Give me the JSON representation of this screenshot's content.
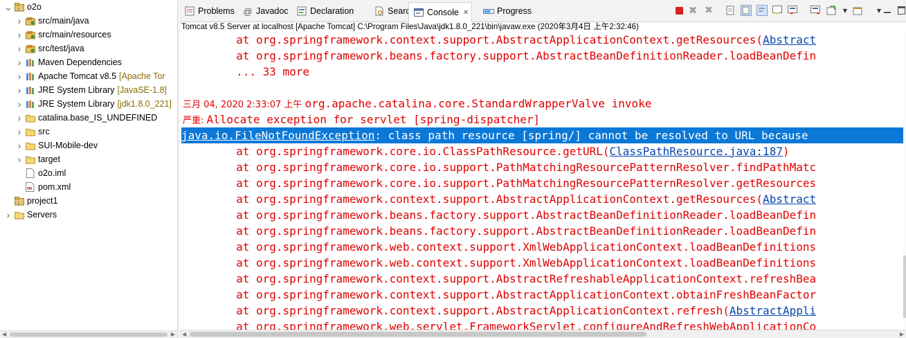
{
  "tree": {
    "items": [
      {
        "label": "o2o",
        "deco": "",
        "icon": "project-icon",
        "expanded": true
      },
      {
        "label": "src/main/java",
        "deco": "",
        "icon": "source-folder-icon",
        "expanded": false
      },
      {
        "label": "src/main/resources",
        "deco": "",
        "icon": "source-folder-icon",
        "expanded": false
      },
      {
        "label": "src/test/java",
        "deco": "",
        "icon": "source-folder-icon",
        "expanded": false
      },
      {
        "label": "Maven Dependencies",
        "deco": "",
        "icon": "library-icon",
        "expanded": false
      },
      {
        "label": "Apache Tomcat v8.5",
        "deco": "[Apache Tor",
        "icon": "library-icon",
        "expanded": false
      },
      {
        "label": "JRE System Library",
        "deco": "[JavaSE-1.8]",
        "icon": "library-icon",
        "expanded": false
      },
      {
        "label": "JRE System Library",
        "deco": "[jdk1.8.0_221]",
        "icon": "library-icon",
        "expanded": false
      },
      {
        "label": "catalina.base_IS_UNDEFINED",
        "deco": "",
        "icon": "folder-icon",
        "expanded": false
      },
      {
        "label": "src",
        "deco": "",
        "icon": "folder-icon",
        "expanded": false
      },
      {
        "label": "SUI-Mobile-dev",
        "deco": "",
        "icon": "folder-icon",
        "expanded": false
      },
      {
        "label": "target",
        "deco": "",
        "icon": "folder-icon",
        "expanded": false
      },
      {
        "label": "o2o.iml",
        "deco": "",
        "icon": "file-icon",
        "expanded": null
      },
      {
        "label": "pom.xml",
        "deco": "",
        "icon": "xml-file-icon",
        "expanded": null
      },
      {
        "label": "project1",
        "deco": "",
        "icon": "project-icon",
        "expanded": null
      },
      {
        "label": "Servers",
        "deco": "",
        "icon": "folder-icon",
        "expanded": false
      }
    ]
  },
  "tabs": [
    {
      "label": "Problems",
      "icon": "problems-icon",
      "active": false
    },
    {
      "label": "Javadoc",
      "icon": "javadoc-icon",
      "active": false
    },
    {
      "label": "Declaration",
      "icon": "declaration-icon",
      "active": false
    },
    {
      "label": "Search",
      "icon": "search-icon",
      "active": false
    },
    {
      "label": "Console",
      "icon": "console-icon",
      "active": true
    },
    {
      "label": "Progress",
      "icon": "progress-icon",
      "active": false
    }
  ],
  "toolbar": {
    "icons": [
      "terminate-icon",
      "remove-launch-icon",
      "remove-all-icon",
      "clear-console-icon",
      "scroll-lock-icon",
      "word-wrap-icon",
      "show-on-stdout-icon",
      "show-on-stderr-icon",
      "pin-console-icon",
      "display-console-icon",
      "chevron-down-icon",
      "new-console-icon",
      "chevron-down-icon",
      "minimize-icon",
      "maximize-icon"
    ]
  },
  "console": {
    "process_title": "Tomcat v8.5 Server at localhost [Apache Tomcat] C:\\Program Files\\Java\\jdk1.8.0_221\\bin\\javaw.exe (2020年3月4日 上午2:32:46)",
    "lines": [
      {
        "pre": "        at org.springframework.context.support.AbstractApplicationContext.getResources(",
        "link": "Abstract",
        "post": ""
      },
      {
        "pre": "        at org.springframework.beans.factory.support.AbstractBeanDefinitionReader.loadBeanDefin",
        "link": "",
        "post": ""
      },
      {
        "pre": "        ... 33 more",
        "link": "",
        "post": ""
      },
      {
        "pre": "",
        "link": "",
        "post": ""
      },
      {
        "cjk": "三月 04, 2020 2:33:07 上午 ",
        "pre": "org.apache.catalina.core.StandardWrapperValve invoke",
        "link": "",
        "post": ""
      },
      {
        "cjk": "严重: ",
        "pre": "Allocate exception for servlet [spring-dispatcher]",
        "link": "",
        "post": ""
      },
      {
        "pre": "",
        "link": "java.io.FileNotFoundException",
        "post": ": class path resource [spring/] cannot be resolved to URL because",
        "selected": true
      },
      {
        "pre": "        at org.springframework.core.io.ClassPathResource.getURL(",
        "link": "ClassPathResource.java:187",
        "post": ")"
      },
      {
        "pre": "        at org.springframework.core.io.support.PathMatchingResourcePatternResolver.findPathMatc",
        "link": "",
        "post": ""
      },
      {
        "pre": "        at org.springframework.core.io.support.PathMatchingResourcePatternResolver.getResources",
        "link": "",
        "post": ""
      },
      {
        "pre": "        at org.springframework.context.support.AbstractApplicationContext.getResources(",
        "link": "Abstract",
        "post": ""
      },
      {
        "pre": "        at org.springframework.beans.factory.support.AbstractBeanDefinitionReader.loadBeanDefin",
        "link": "",
        "post": ""
      },
      {
        "pre": "        at org.springframework.beans.factory.support.AbstractBeanDefinitionReader.loadBeanDefin",
        "link": "",
        "post": ""
      },
      {
        "pre": "        at org.springframework.web.context.support.XmlWebApplicationContext.loadBeanDefinitions",
        "link": "",
        "post": ""
      },
      {
        "pre": "        at org.springframework.web.context.support.XmlWebApplicationContext.loadBeanDefinitions",
        "link": "",
        "post": ""
      },
      {
        "pre": "        at org.springframework.context.support.AbstractRefreshableApplicationContext.refreshBea",
        "link": "",
        "post": ""
      },
      {
        "pre": "        at org.springframework.context.support.AbstractApplicationContext.obtainFreshBeanFactor",
        "link": "",
        "post": ""
      },
      {
        "pre": "        at org.springframework.context.support.AbstractApplicationContext.refresh(",
        "link": "AbstractAppli",
        "post": ""
      },
      {
        "pre": "        at org.springframework.web.servlet.FrameworkServlet.configureAndRefreshWebApplicationCo",
        "link": "",
        "post": ""
      }
    ]
  },
  "colors": {
    "error_text": "#e00000",
    "link": "#0645ad",
    "selection": "#0b78d7",
    "decoration": "#8a6d00"
  }
}
